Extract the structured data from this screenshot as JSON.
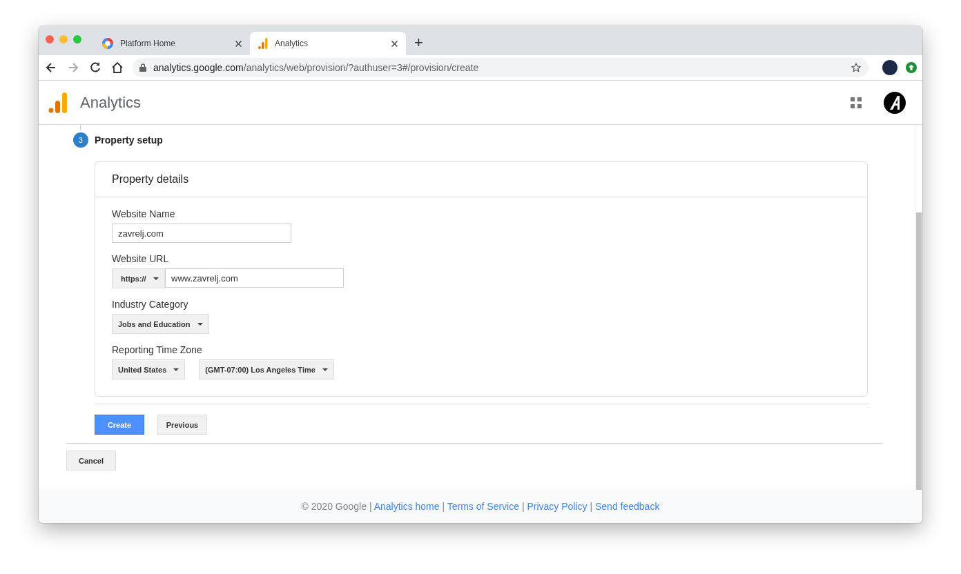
{
  "browser": {
    "tabs": [
      {
        "title": "Platform Home",
        "selected": false
      },
      {
        "title": "Analytics",
        "selected": true
      }
    ],
    "new_tab": "+",
    "address": {
      "host": "analytics.google.com",
      "path": "/analytics/web/provision/?authuser=3#/provision/create"
    }
  },
  "app_bar": {
    "title": "Analytics"
  },
  "step": {
    "number": "3",
    "title": "Property setup"
  },
  "card": {
    "title": "Property details",
    "fields": [
      {
        "label": "Website Name",
        "controls": [
          {
            "kind": "input",
            "value": "zavrelj.com"
          }
        ]
      },
      {
        "label": "Website URL",
        "controls": [
          {
            "kind": "prefix",
            "value": "https://"
          },
          {
            "kind": "input",
            "value": "www.zavrelj.com"
          }
        ]
      },
      {
        "label": "Industry Category",
        "controls": [
          {
            "kind": "select",
            "value": "Jobs and Education"
          }
        ]
      },
      {
        "label": "Reporting Time Zone",
        "controls": [
          {
            "kind": "select",
            "value": "United States"
          },
          {
            "kind": "select",
            "value": "(GMT-07:00) Los Angeles Time"
          }
        ]
      }
    ]
  },
  "actions": [
    {
      "label": "Create",
      "primary": true
    },
    {
      "label": "Previous",
      "primary": false
    }
  ],
  "cancel": "Cancel",
  "footer": [
    {
      "kind": "text",
      "text": "© 2020 Google"
    },
    {
      "kind": "sep",
      "text": "|"
    },
    {
      "kind": "link",
      "text": "Analytics home"
    },
    {
      "kind": "sep",
      "text": "|"
    },
    {
      "kind": "link",
      "text": "Terms of Service"
    },
    {
      "kind": "sep",
      "text": "|"
    },
    {
      "kind": "link",
      "text": "Privacy Policy"
    },
    {
      "kind": "sep",
      "text": "|"
    },
    {
      "kind": "link",
      "text": "Send feedback"
    }
  ]
}
